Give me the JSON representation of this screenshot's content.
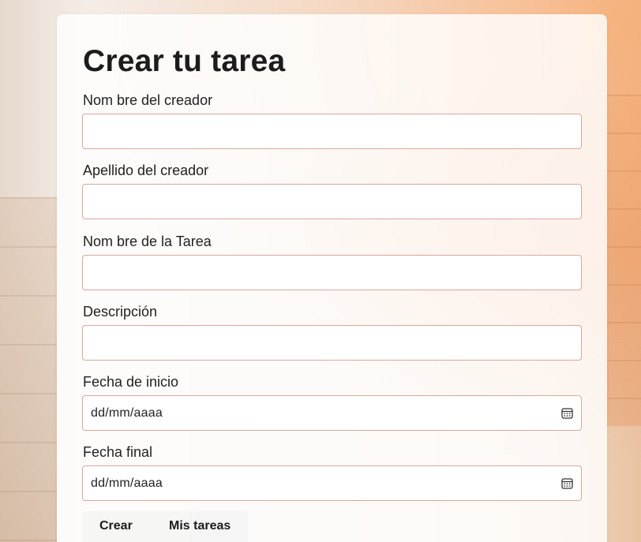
{
  "form": {
    "title": "Crear tu tarea",
    "fields": [
      {
        "label": "Nom bre del creador",
        "value": ""
      },
      {
        "label": "Apellido del creador",
        "value": ""
      },
      {
        "label": "Nom bre de la Tarea",
        "value": ""
      },
      {
        "label": "Descripción",
        "value": ""
      },
      {
        "label": "Fecha de inicio",
        "placeholder": "dd/mm/aaaa",
        "icon": "calendar-icon"
      },
      {
        "label": "Fecha final",
        "placeholder": "dd/mm/aaaa",
        "icon": "calendar-icon"
      }
    ],
    "buttons": {
      "create": "Crear",
      "my_tasks": "Mis tareas"
    }
  },
  "colors": {
    "input_border": "#d9a79f",
    "title_text": "#1c1c1c"
  }
}
